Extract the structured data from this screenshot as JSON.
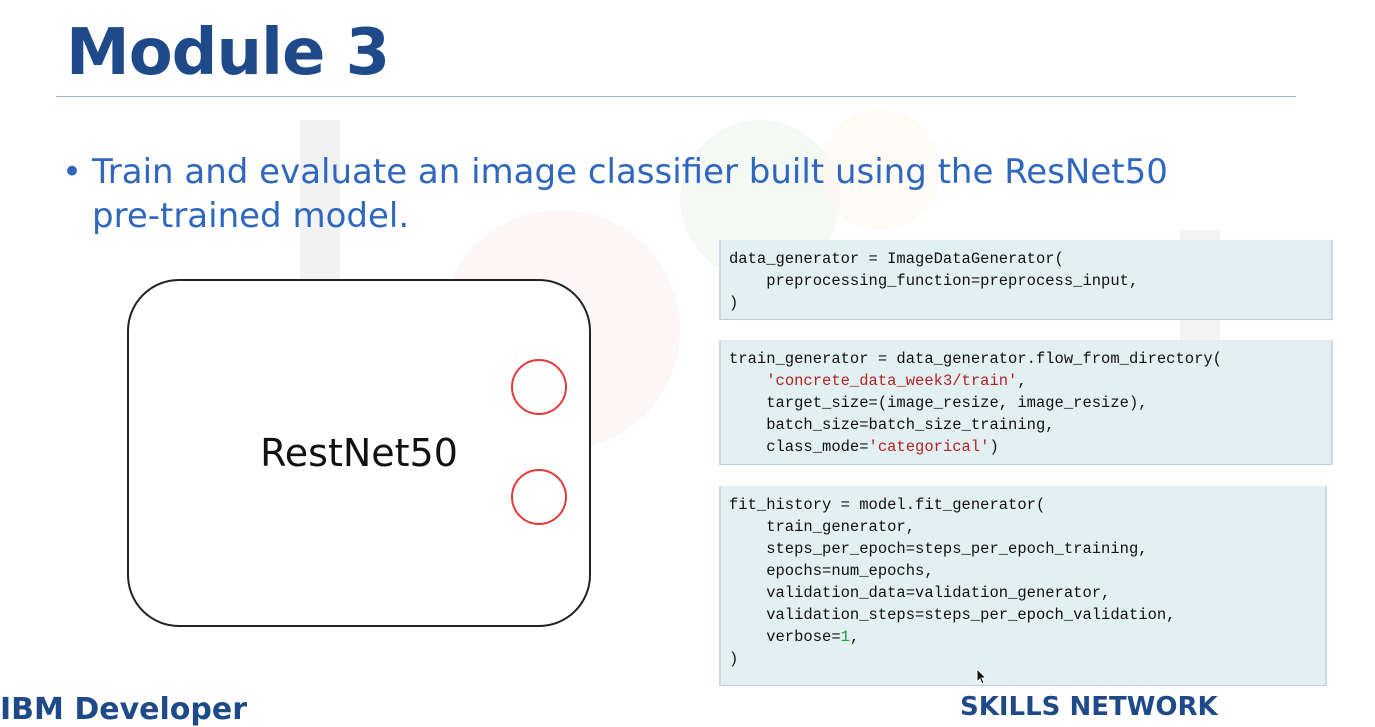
{
  "slide": {
    "title": "Module 3",
    "bullet_marker": "•",
    "bullet_text": "Train and evaluate an image classifier built using the ResNet50 pre-trained model."
  },
  "diagram": {
    "model_label": "RestNet50"
  },
  "code_blocks": {
    "block1": [
      "data_generator = ImageDataGenerator(",
      "    preprocessing_function=preprocess_input,",
      ")"
    ],
    "block2": {
      "line1": "train_generator = data_generator.flow_from_directory(",
      "line2_str": "'concrete_data_week3/train'",
      "line2_tail": ",",
      "line3": "    target_size=(image_resize, image_resize),",
      "line4": "    batch_size=batch_size_training,",
      "line5_head": "    class_mode=",
      "line5_str": "'categorical'",
      "line5_tail": ")"
    },
    "block3": {
      "line1": "fit_history = model.fit_generator(",
      "line2": "    train_generator,",
      "line3": "    steps_per_epoch=steps_per_epoch_training,",
      "line4": "    epochs=num_epochs,",
      "line5": "    validation_data=validation_generator,",
      "line6": "    validation_steps=steps_per_epoch_validation,",
      "line7_head": "    verbose=",
      "line7_num": "1",
      "line7_tail": ",",
      "line8": ")"
    }
  },
  "footer": {
    "left": "IBM Developer",
    "right": "SKILLS NETWORK"
  },
  "icons": [
    "mouse-cursor-icon",
    "port-circle-icon"
  ],
  "colors": {
    "title": "#1f4a8a",
    "bullet": "#2f67c0",
    "port_stroke": "#e33b3b",
    "code_bg": "#e3f0f2",
    "string": "#b22222",
    "number": "#1a9b3c"
  }
}
